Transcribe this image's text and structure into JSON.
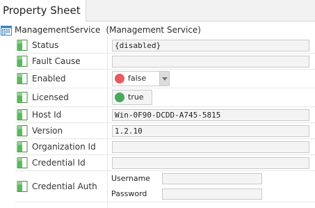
{
  "tab": {
    "label": "Property Sheet"
  },
  "object": {
    "name": "ManagementService",
    "type": "(Management Service)"
  },
  "icons": {
    "object": "calendar-grid-icon",
    "property": "green-slot-icon"
  },
  "colors": {
    "false_dot": "#e85a63",
    "true_dot": "#49a95a",
    "slot_green": "#5cb85c"
  },
  "properties": {
    "status": {
      "label": "Status",
      "value": "{disabled}"
    },
    "fault_cause": {
      "label": "Fault Cause",
      "value": ""
    },
    "enabled": {
      "label": "Enabled",
      "value": "false"
    },
    "licensed": {
      "label": "Licensed",
      "value": "true"
    },
    "host_id": {
      "label": "Host Id",
      "value": "Win-0F90-DCDD-A745-5815"
    },
    "version": {
      "label": "Version",
      "value": "1.2.10"
    },
    "organization_id": {
      "label": "Organization Id",
      "value": ""
    },
    "credential_id": {
      "label": "Credential Id",
      "value": ""
    },
    "credential_auth": {
      "label": "Credential Auth",
      "username_label": "Username",
      "username_value": "",
      "password_label": "Password",
      "password_value": ""
    }
  }
}
